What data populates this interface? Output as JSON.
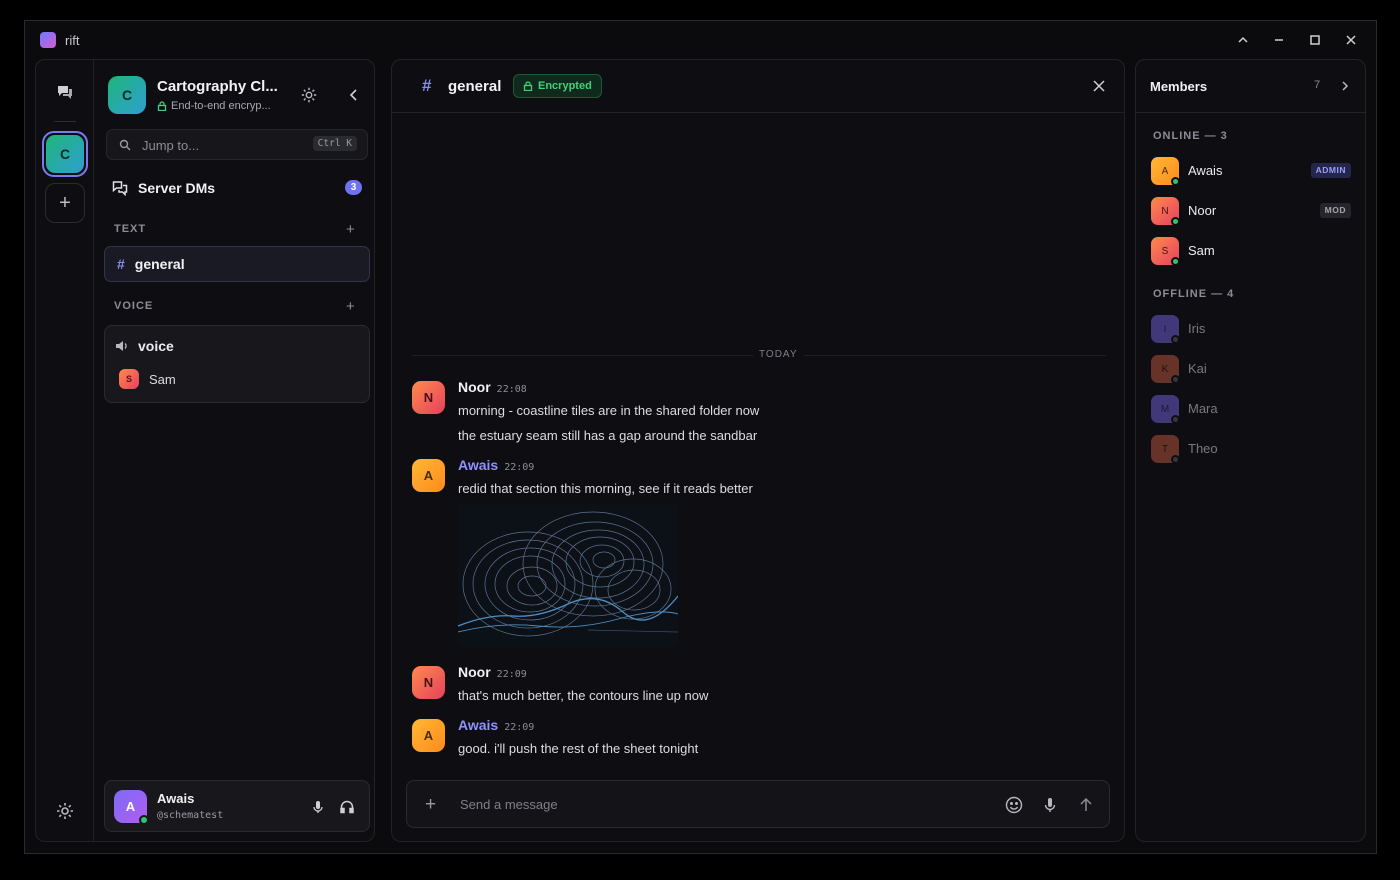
{
  "app": {
    "title": "rift"
  },
  "server": {
    "initial": "C",
    "name": "Cartography Cl...",
    "subtitle": "End-to-end encryp...",
    "jump_placeholder": "Jump to...",
    "jump_shortcut": "Ctrl K",
    "dms_label": "Server DMs",
    "dms_badge": "3",
    "text_section": "TEXT",
    "voice_section": "VOICE",
    "text_channels": [
      {
        "name": "general"
      }
    ],
    "voice_channel": {
      "name": "voice",
      "users": [
        {
          "initial": "S",
          "name": "Sam"
        }
      ]
    }
  },
  "user": {
    "initial": "A",
    "name": "Awais",
    "handle": "@schematest",
    "status": "online"
  },
  "channel": {
    "name": "general",
    "badge": "Encrypted",
    "divider": "TODAY",
    "messages": [
      {
        "author": "Noor",
        "initial": "N",
        "time": "22:08",
        "lines": [
          "morning - coastline tiles are in the shared folder now",
          "the estuary seam still has a gap around the sandbar"
        ]
      },
      {
        "author": "Awais",
        "initial": "A",
        "time": "22:09",
        "lines": [
          "redid that section this morning, see if it reads better"
        ],
        "attachment": "contour-map-image"
      },
      {
        "author": "Noor",
        "initial": "N",
        "time": "22:09",
        "lines": [
          "that's much better, the contours line up now"
        ]
      },
      {
        "author": "Awais",
        "initial": "A",
        "time": "22:09",
        "lines": [
          "good. i'll push the rest of the sheet tonight"
        ]
      }
    ],
    "composer_placeholder": "Send a message"
  },
  "members": {
    "title": "Members",
    "count": "7",
    "online_label": "ONLINE — 3",
    "offline_label": "OFFLINE — 4",
    "online": [
      {
        "initial": "A",
        "name": "Awais",
        "role": "ADMIN"
      },
      {
        "initial": "N",
        "name": "Noor",
        "role": "MOD"
      },
      {
        "initial": "S",
        "name": "Sam",
        "role": ""
      }
    ],
    "offline": [
      {
        "initial": "I",
        "name": "Iris"
      },
      {
        "initial": "K",
        "name": "Kai"
      },
      {
        "initial": "M",
        "name": "Mara"
      },
      {
        "initial": "T",
        "name": "Theo"
      }
    ]
  },
  "colors": {
    "accent": "#6f72f2",
    "online": "#2fc56a",
    "encrypted": "#3fd17c",
    "background": "#0b0b0e"
  }
}
